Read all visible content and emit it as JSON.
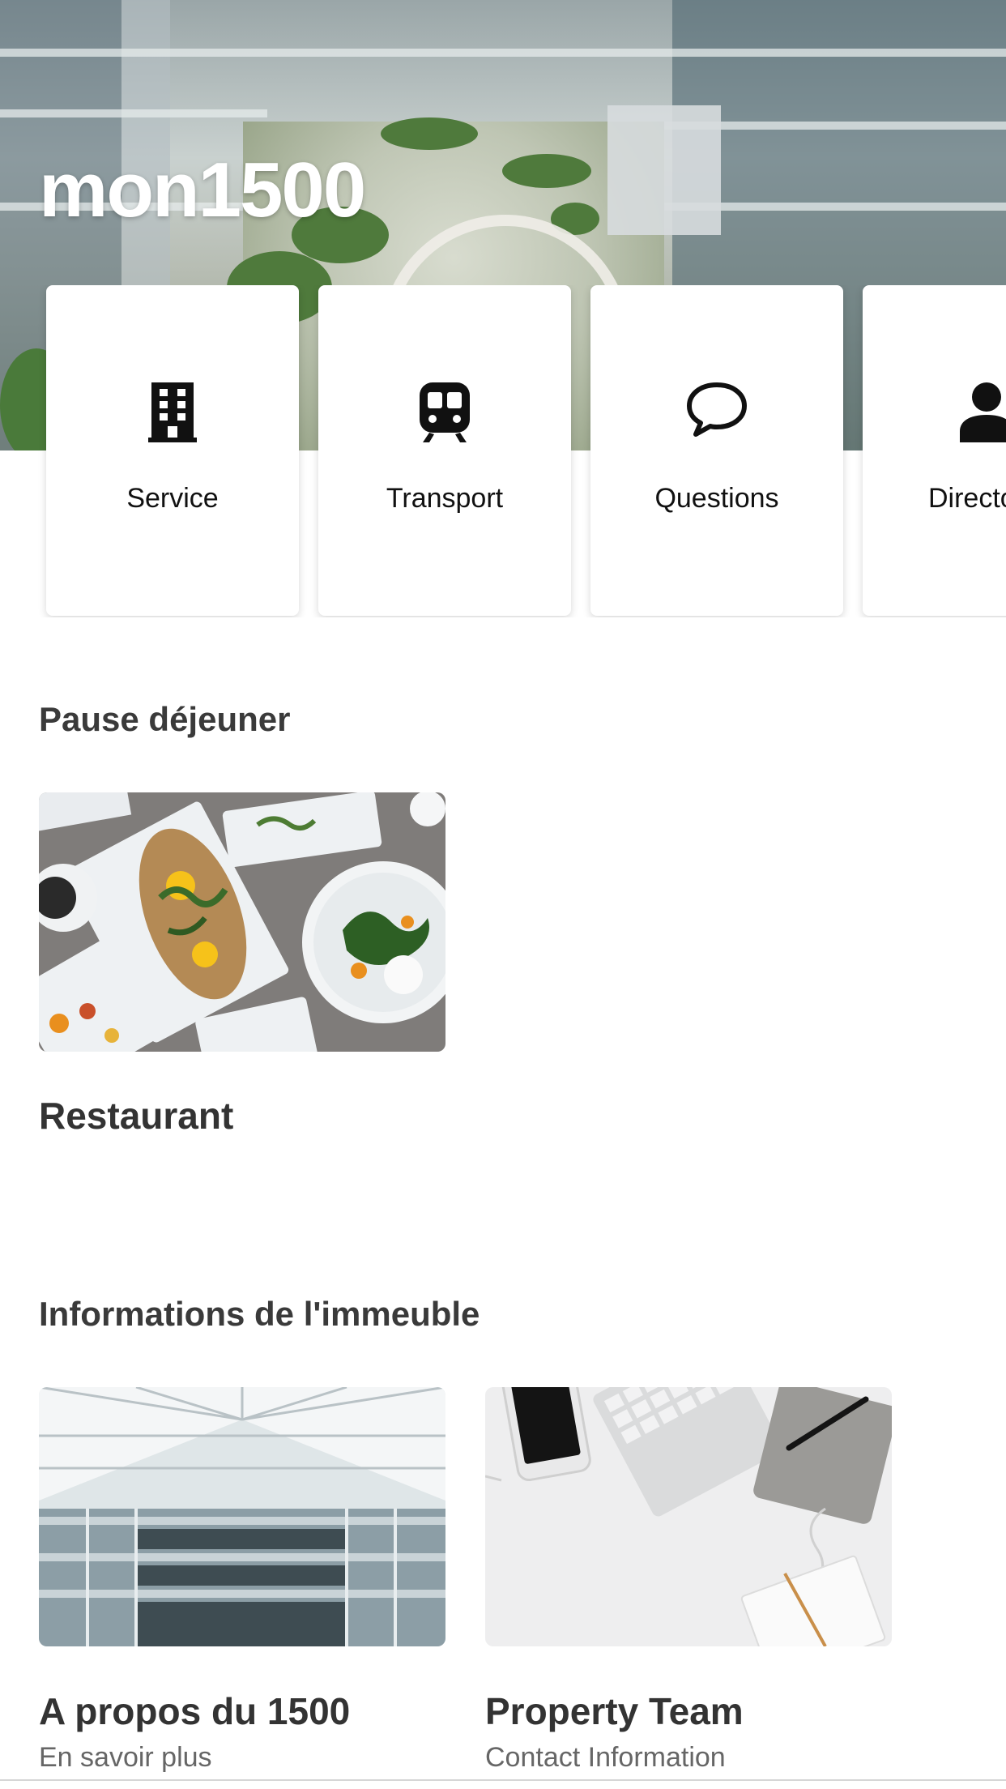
{
  "header": {
    "title": "mon1500"
  },
  "quick_links": [
    {
      "label": "Service",
      "icon": "building-icon"
    },
    {
      "label": "Transport",
      "icon": "train-icon"
    },
    {
      "label": "Questions",
      "icon": "speech-bubble-icon"
    },
    {
      "label": "Directory",
      "icon": "person-icon"
    }
  ],
  "sections": [
    {
      "title": "Pause déjeuner",
      "cards": [
        {
          "title": "Restaurant",
          "subtitle": "",
          "image": "food-plates-photo"
        }
      ]
    },
    {
      "title": "Informations de l'immeuble",
      "cards": [
        {
          "title": "A propos du 1500",
          "subtitle": "En savoir plus",
          "image": "glass-atrium-photo"
        },
        {
          "title": "Property Team",
          "subtitle": "Contact Information",
          "image": "desk-workspace-photo"
        }
      ]
    }
  ]
}
